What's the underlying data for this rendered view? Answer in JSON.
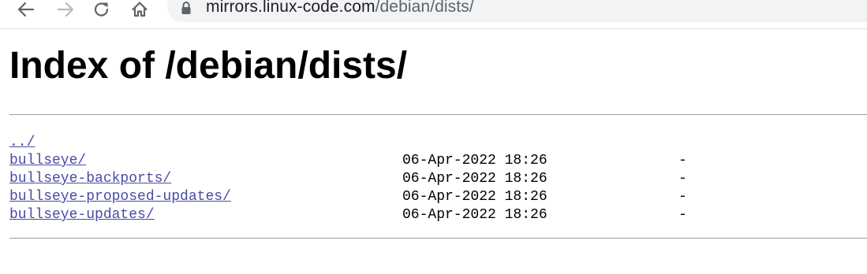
{
  "browser": {
    "icons": {
      "back": "arrow-left-icon",
      "forward": "arrow-right-icon",
      "reload": "reload-icon",
      "home": "home-icon",
      "lock": "lock-icon"
    },
    "url_host": "mirrors.linux-code.com",
    "url_path": "/debian/dists/"
  },
  "page": {
    "title": "Index of /debian/dists/",
    "entries": [
      {
        "name": "../",
        "date": "",
        "size": ""
      },
      {
        "name": "bullseye/",
        "date": "06-Apr-2022 18:26",
        "size": "-"
      },
      {
        "name": "bullseye-backports/",
        "date": "06-Apr-2022 18:26",
        "size": "-"
      },
      {
        "name": "bullseye-proposed-updates/",
        "date": "06-Apr-2022 18:26",
        "size": "-"
      },
      {
        "name": "bullseye-updates/",
        "date": "06-Apr-2022 18:26",
        "size": "-"
      }
    ]
  },
  "colors": {
    "link": "#4a4aa8",
    "omnibox_bg": "#f1f3f4",
    "rule": "#a0a0a0"
  }
}
